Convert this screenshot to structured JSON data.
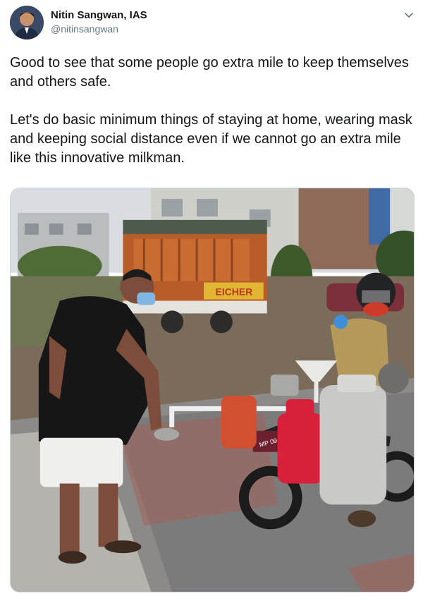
{
  "author": {
    "name": "Nitin Sangwan, IAS",
    "handle": "@nitinsangwan"
  },
  "tweet": {
    "paragraphs": [
      "Good to see that some people go extra mile to keep themselves and others safe.",
      "Let's do basic minimum things of staying at home, wearing mask and keeping social distance even if we cannot go an extra mile like this innovative milkman."
    ]
  },
  "photo": {
    "truck_brand": "EICHER",
    "plate_text": "MP 09"
  },
  "icons": {
    "menu": "chevron-down-icon",
    "avatar": "profile-photo"
  },
  "colors": {
    "name_text": "#14171a",
    "secondary_text": "#657786",
    "border": "#ccd6dd"
  }
}
